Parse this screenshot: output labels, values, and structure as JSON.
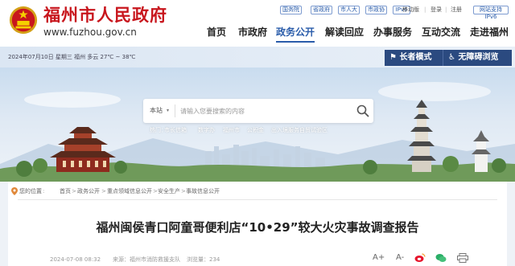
{
  "header": {
    "title": "福州市人民政府",
    "url": "www.fuzhou.gov.cn",
    "utility_links": [
      "国务院",
      "省政府",
      "市人大",
      "市政协",
      "IPv6"
    ],
    "account_links": [
      "移动版",
      "登录",
      "注册"
    ],
    "ipv6_badge": "网站支持IPv6"
  },
  "nav": {
    "items": [
      "首页",
      "市政府",
      "政务公开",
      "解读回应",
      "办事服务",
      "互动交流",
      "走进福州"
    ],
    "active": "政务公开"
  },
  "infobar": {
    "date_weather": "2024年07月10日 星期三 福州 多云 27℃ ~ 38℃",
    "elder_mode": "长者模式",
    "accessibility": "无障碍浏览"
  },
  "search": {
    "scope": "本站",
    "placeholder": "请输入您要搜索的内容",
    "hot_words": [
      "热门：",
      "市长信箱",
      "数字办",
      "福州市",
      "公积金",
      "出入境服务",
      "自贸试验区"
    ]
  },
  "breadcrumb": [
    "您的位置",
    "首页",
    "政务公开",
    "重点领域信息公开",
    "安全生产",
    "事故信息公开"
  ],
  "article": {
    "title": "福州闽侯青口阿童哥便利店“10•29”较大火灾事故调查报告",
    "date": "2024-07-08 08:32",
    "source": "来源：福州市消防救援支队",
    "views": "浏览量：234",
    "tools": [
      "A+",
      "A-"
    ]
  },
  "colors": {
    "brand_red": "#c8161d",
    "nav_blue": "#2a5caa",
    "bar_blue": "#2b4a80"
  },
  "icons": [
    "emblem-icon",
    "elder-icon",
    "accessibility-icon",
    "search-icon",
    "weibo-icon",
    "wechat-icon",
    "print-icon",
    "location-icon"
  ]
}
